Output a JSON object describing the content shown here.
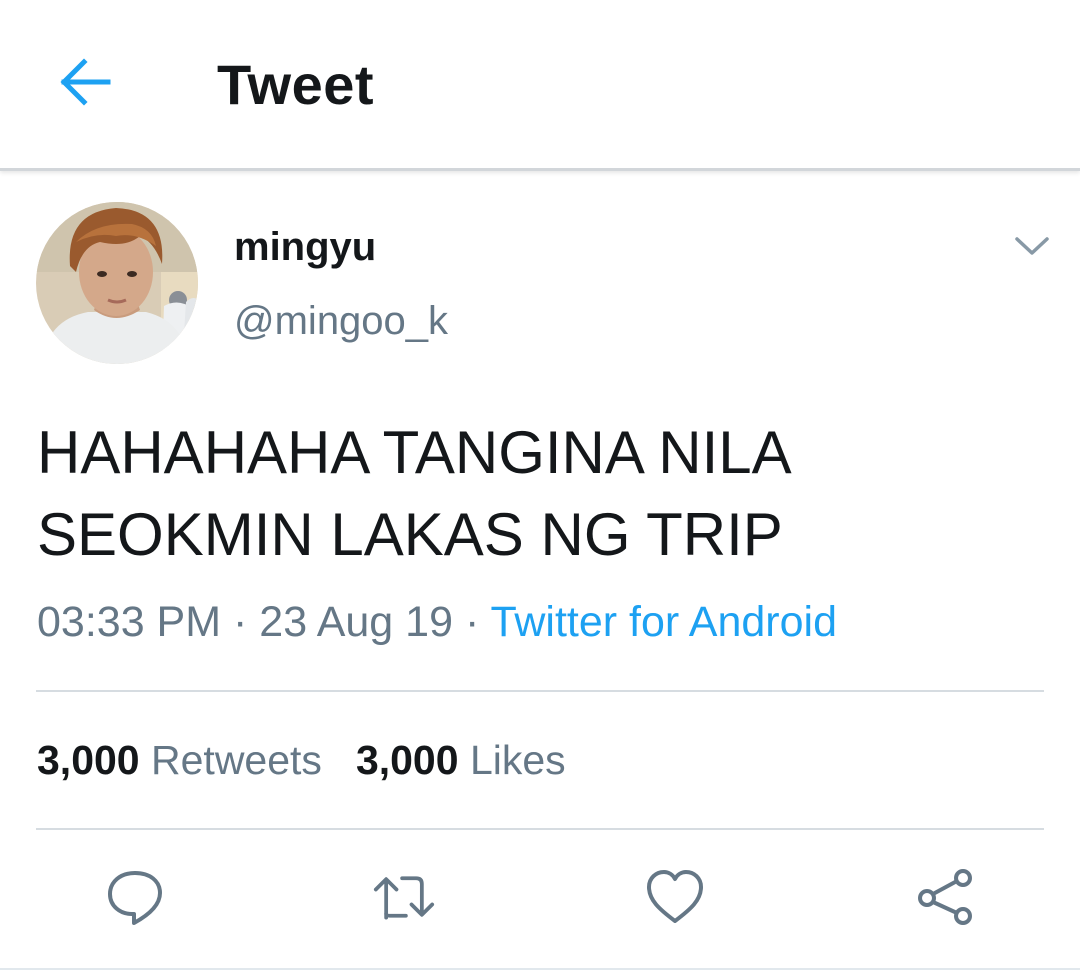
{
  "header": {
    "back_icon": "arrow-left-icon",
    "title": "Tweet",
    "accent": "#1da1f2"
  },
  "tweet": {
    "author": {
      "name": "mingyu",
      "handle": "@mingoo_k",
      "avatar": "profile-photo"
    },
    "text_lines": [
      "HAHAHAHA TANGINA NILA",
      "SEOKMIN LAKAS NG TRIP"
    ],
    "time": "03:33 PM",
    "date": "23 Aug 19",
    "separator": "·",
    "source": "Twitter for Android",
    "stats": {
      "retweets": {
        "count": "3,000",
        "label": "Retweets"
      },
      "likes": {
        "count": "3,000",
        "label": "Likes"
      }
    },
    "actions": [
      {
        "name": "reply",
        "icon": "reply-bubble-icon"
      },
      {
        "name": "retweet",
        "icon": "retweet-icon"
      },
      {
        "name": "like",
        "icon": "heart-icon"
      },
      {
        "name": "share",
        "icon": "share-icon"
      }
    ]
  },
  "colors": {
    "text": "#14171a",
    "secondary": "#657786",
    "link": "#1da1f2",
    "divider": "#d6dce1"
  }
}
